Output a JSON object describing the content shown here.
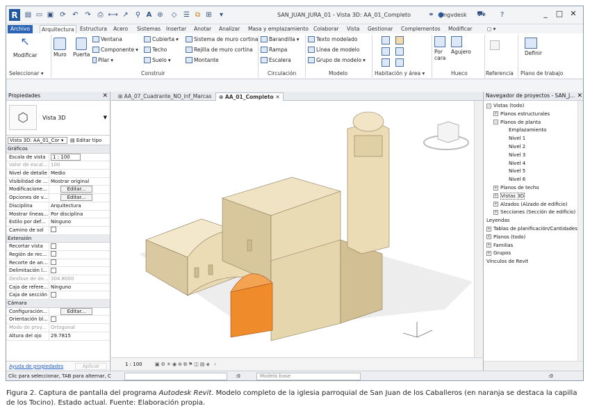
{
  "app": {
    "doc_title": "SAN_JUAN_JURA_01 - Vista 3D: AA_01_Completo",
    "user": "jmgvdesk"
  },
  "ribbon_tabs": [
    "Archivo",
    "Arquitectura",
    "Estructura",
    "Acero",
    "Sistemas",
    "Insertar",
    "Anotar",
    "Analizar",
    "Masa y emplazamiento",
    "Colaborar",
    "Vista",
    "Gestionar",
    "Complementos",
    "Modificar"
  ],
  "ribbon": {
    "modificar": "Modificar",
    "muro": "Muro",
    "puerta": "Puerta",
    "ventana": "Ventana",
    "componente": "Componente",
    "pilar": "Pilar",
    "cubierta": "Cubierta",
    "techo": "Techo",
    "suelo": "Suelo",
    "sistema_muro": "Sistema de muro cortina",
    "rejilla_muro": "Rejilla de muro cortina",
    "montante": "Montante",
    "barandilla": "Barandilla",
    "rampa": "Rampa",
    "escalera": "Escalera",
    "texto_modelado": "Texto modelado",
    "linea_modelo": "Línea de modelo",
    "grupo_modelo": "Grupo de modelo",
    "por_cara": "Por\ncara",
    "agujero": "Agujero",
    "definir": "Definir",
    "panels": {
      "seleccionar": "Seleccionar",
      "construir": "Construir",
      "circulacion": "Circulación",
      "modelo": "Modelo",
      "habitacion": "Habitación y área",
      "hueco": "Hueco",
      "referencia": "Referencia",
      "plano_trabajo": "Plano de trabajo"
    }
  },
  "properties": {
    "title": "Propiedades",
    "type_name": "Vista 3D",
    "instance_selector": "Vista 3D: AA_01_Cor",
    "edit_type": "Editar tipo",
    "sections": {
      "graficos": "Gráficos",
      "extension": "Extensión",
      "camara": "Cámara"
    },
    "graficos_rows": [
      {
        "k": "Escala de vista",
        "v": "1 : 100"
      },
      {
        "k": "Valor de escal...",
        "v": "100"
      },
      {
        "k": "Nivel de detalle",
        "v": "Medio"
      },
      {
        "k": "Visibilidad de ...",
        "v": "Mostrar original"
      },
      {
        "k": "Modificacione...",
        "v": "Editar..."
      },
      {
        "k": "Opciones de v...",
        "v": "Editar..."
      },
      {
        "k": "Disciplina",
        "v": "Arquitectura"
      },
      {
        "k": "Mostrar líneas...",
        "v": "Por disciplina"
      },
      {
        "k": "Estilo por def...",
        "v": "Ninguno"
      },
      {
        "k": "Camino de sol",
        "v": ""
      }
    ],
    "extension_rows": [
      {
        "k": "Recortar vista",
        "v": ""
      },
      {
        "k": "Región de rec...",
        "v": ""
      },
      {
        "k": "Recorte de an...",
        "v": ""
      },
      {
        "k": "Delimitación l...",
        "v": ""
      },
      {
        "k": "Desfase de de...",
        "v": "304.8000"
      },
      {
        "k": "Caja de refere...",
        "v": "Ninguno"
      },
      {
        "k": "Caja de sección",
        "v": ""
      }
    ],
    "camara_rows": [
      {
        "k": "Configuración...",
        "v": "Editar..."
      },
      {
        "k": "Orientación bl...",
        "v": ""
      },
      {
        "k": "Modo de proy...",
        "v": "Ortogonal"
      },
      {
        "k": "Altura del ojo",
        "v": "29.7815"
      }
    ],
    "help_link": "Ayuda de propiedades",
    "apply": "Aplicar"
  },
  "view_tabs": [
    "AA_07_Cuadrante_NO_inf_Marcas",
    "AA_01_Completo"
  ],
  "view_scale": "1 : 100",
  "navigator": {
    "title": "Navegador de proyectos - SAN_J...",
    "items": [
      "Vistas (todo)",
      "Planos estructurales",
      "Planos de planta",
      "Emplazamiento",
      "Nivel 1",
      "Nivel 2",
      "Nivel 3",
      "Nivel 4",
      "Nivel 5",
      "Nivel 6",
      "Planos de techo",
      "Vistas 3D",
      "Alzados (Alzado de edificio)",
      "Secciones (Sección de edificio)",
      "Leyendas",
      "Tablas de planificación/Cantidades",
      "Planos (todo)",
      "Familias",
      "Grupos",
      "Vínculos de Revit"
    ]
  },
  "status": {
    "hint": "Clic para seleccionar, TAB para alternar, C",
    "count": ":0",
    "model": "Modelo base",
    "filter": ":0"
  },
  "caption": {
    "pre": "Figura 2. Captura de pantalla del programa ",
    "italic": "Autodesk Revit",
    "post": ". Modelo completo de la iglesia parroquial de San Juan de los Caballeros (en naranja se destaca la capilla de los Tocino). Estado actual. Fuente: Elaboración propia."
  },
  "colors": {
    "accent": "#2b64b4",
    "model": "#efe3c4",
    "model_shade": "#c9b78e",
    "chapel": "#ef8b2b"
  }
}
